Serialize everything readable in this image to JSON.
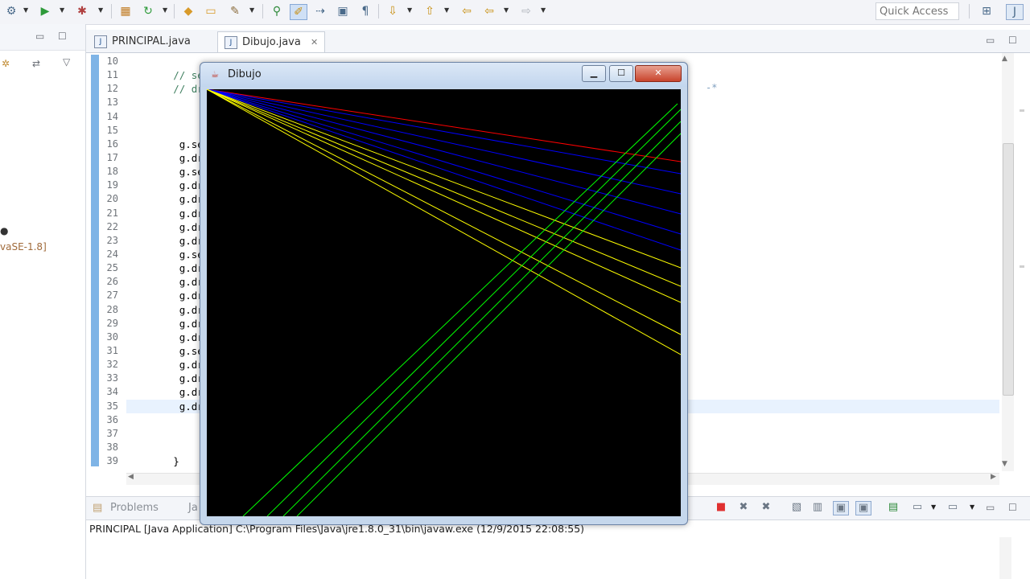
{
  "toolbar": {
    "icons": [
      "settings-icon",
      "run-icon",
      "debug-icon",
      "new-package-icon",
      "refresh-icon",
      "open-type-icon",
      "folder-icon",
      "brush-icon",
      "pin-icon",
      "highlight-icon",
      "step-icon",
      "save-icon",
      "show-whitespace-icon",
      "annotation-icon",
      "pin-editor-icon",
      "back-icon",
      "back-history-icon",
      "forward-icon"
    ],
    "quick_access_placeholder": "Quick Access"
  },
  "left_panel": {
    "jre_label": "vaSE-1.8]"
  },
  "editor": {
    "tabs": [
      {
        "label": "PRINCIPAL.java",
        "active": false
      },
      {
        "label": "Dibujo.java",
        "active": true
      }
    ],
    "line_numbers": [
      "10",
      "11",
      "12",
      "13",
      "14",
      "15",
      "16",
      "17",
      "18",
      "19",
      "20",
      "21",
      "22",
      "23",
      "24",
      "25",
      "26",
      "27",
      "28",
      "29",
      "30",
      "31",
      "32",
      "33",
      "34",
      "35",
      "36",
      "37",
      "38",
      "39"
    ],
    "code_lines": [
      {
        "text": "",
        "comment": false
      },
      {
        "text": "        // setC",
        "comment": true
      },
      {
        "text": "        // draw",
        "comment": true
      },
      {
        "text": "",
        "comment": false
      },
      {
        "text": "",
        "comment": false
      },
      {
        "text": "",
        "comment": false
      },
      {
        "text": "         g.setC",
        "comment": false
      },
      {
        "text": "         g.draw",
        "comment": false
      },
      {
        "text": "         g.setC",
        "comment": false
      },
      {
        "text": "         g.draw",
        "comment": false
      },
      {
        "text": "         g.draw",
        "comment": false
      },
      {
        "text": "         g.draw",
        "comment": false
      },
      {
        "text": "         g.draw",
        "comment": false
      },
      {
        "text": "         g.draw",
        "comment": false
      },
      {
        "text": "         g.setC",
        "comment": false
      },
      {
        "text": "         g.draw",
        "comment": false
      },
      {
        "text": "         g.draw",
        "comment": false
      },
      {
        "text": "         g.draw",
        "comment": false
      },
      {
        "text": "         g.draw",
        "comment": false
      },
      {
        "text": "         g.draw",
        "comment": false
      },
      {
        "text": "         g.draw",
        "comment": false
      },
      {
        "text": "         g.setC",
        "comment": false
      },
      {
        "text": "         g.draw",
        "comment": false
      },
      {
        "text": "         g.draw",
        "comment": false
      },
      {
        "text": "         g.draw",
        "comment": false
      },
      {
        "text": "         g.draw",
        "comment": false
      },
      {
        "text": "",
        "comment": false
      },
      {
        "text": "",
        "comment": false
      },
      {
        "text": "",
        "comment": false
      },
      {
        "text": "        }",
        "comment": false
      }
    ],
    "comment_tail": "-*"
  },
  "console": {
    "tabs": [
      {
        "label": "Problems"
      },
      {
        "label": "Ja"
      }
    ],
    "description": "PRINCIPAL [Java Application] C:\\Program Files\\Java\\jre1.8.0_31\\bin\\javaw.exe (12/9/2015 22:08:55)",
    "terminate_color": "#e03030"
  },
  "dibujo_window": {
    "title": "Dibujo",
    "controls": [
      "minimize",
      "maximize",
      "close"
    ],
    "canvas_background": "#000000",
    "line_colors": {
      "red": "#ff0000",
      "blue": "#0000ff",
      "yellow": "#ffff00",
      "green": "#00ff00"
    }
  }
}
